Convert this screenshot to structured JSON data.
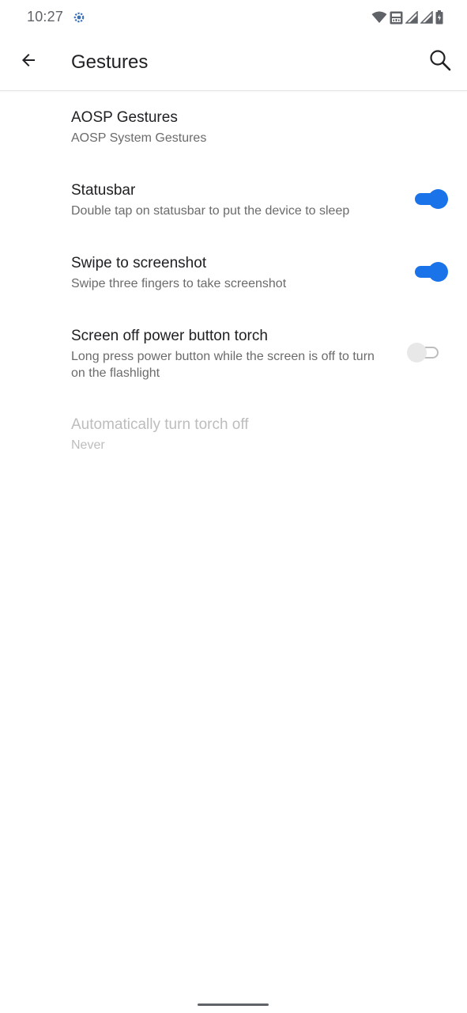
{
  "status_bar": {
    "time": "10:27",
    "app_icon": "gear-notification-icon",
    "icons": [
      "wifi-icon",
      "volte-lte-icon",
      "signal-icon",
      "signal-icon",
      "battery-icon"
    ]
  },
  "app_bar": {
    "title": "Gestures",
    "back_icon": "arrow-back-icon",
    "search_icon": "search-icon"
  },
  "preferences": [
    {
      "title": "AOSP Gestures",
      "summary": "AOSP System Gestures"
    },
    {
      "title": "Statusbar",
      "summary": "Double tap on statusbar to put the device to sleep",
      "switch": "on"
    },
    {
      "title": "Swipe to screenshot",
      "summary": "Swipe three fingers to take screenshot",
      "switch": "on"
    },
    {
      "title": "Screen off power button torch",
      "summary": "Long press power button while the screen is off to turn on the flashlight",
      "switch": "off"
    },
    {
      "title": "Automatically turn torch off",
      "summary": "Never",
      "disabled": true
    }
  ],
  "colors": {
    "accent": "#1a73e8",
    "text_primary": "#202124",
    "text_secondary": "#6b6b6b",
    "text_disabled": "#bdbdbd"
  }
}
